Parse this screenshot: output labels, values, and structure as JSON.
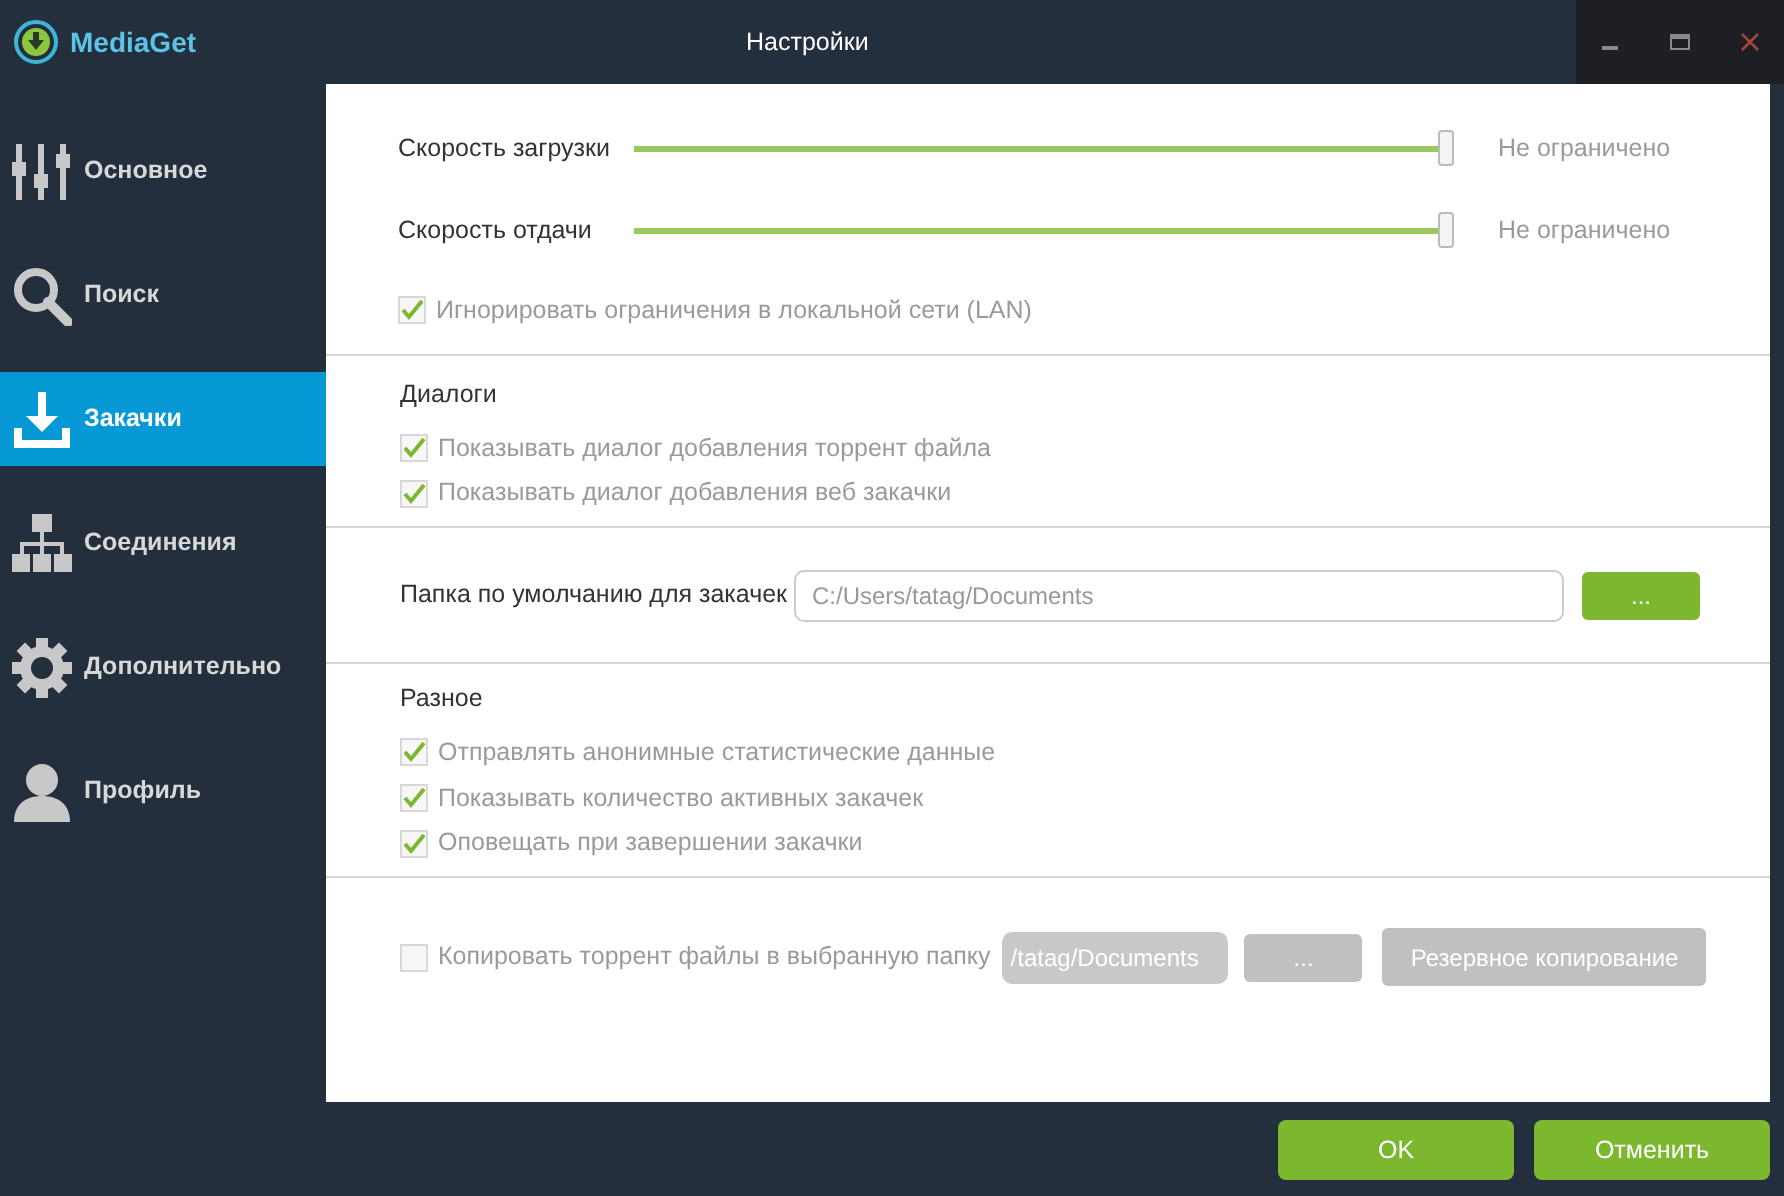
{
  "app": {
    "name": "MediaGet"
  },
  "window": {
    "title": "Настройки"
  },
  "sidebar": {
    "items": [
      {
        "label": "Основное",
        "selected": false
      },
      {
        "label": "Поиск",
        "selected": false
      },
      {
        "label": "Закачки",
        "selected": true
      },
      {
        "label": "Соединения",
        "selected": false
      },
      {
        "label": "Дополнительно",
        "selected": false
      },
      {
        "label": "Профиль",
        "selected": false
      }
    ]
  },
  "speed": {
    "sliders": [
      {
        "label": "Скорость загрузки",
        "level": 1,
        "reading": "Не ограничено"
      },
      {
        "label": "Скорость отдачи",
        "level": 1,
        "reading": "Не ограничено"
      }
    ],
    "options": [
      {
        "label": "Игнорировать ограничения в локальной сети (LAN)",
        "checked": true
      }
    ]
  },
  "dialogs": {
    "title": "Диалоги",
    "options": [
      {
        "label": "Показывать диалог добавления торрент файла",
        "checked": true
      },
      {
        "label": "Показывать диалог добавления веб закачки",
        "checked": true
      }
    ]
  },
  "folder": {
    "label": "Папка по умолчанию для закачек",
    "value": "C:/Users/tatag/Documents",
    "browse": "..."
  },
  "misc": {
    "title": "Разное",
    "options": [
      {
        "label": "Отправлять анонимные статистические данные",
        "checked": true
      },
      {
        "label": "Показывать количество активных закачек",
        "checked": true
      },
      {
        "label": "Оповещать при завершении закачки",
        "checked": true
      }
    ]
  },
  "copy": {
    "label": "Копировать торрент файлы в выбранную папку",
    "checked": false,
    "value": "/tatag/Documents",
    "browse": "...",
    "backup": "Резервное копирование",
    "disabled": true
  },
  "buttons": [
    {
      "label": "OK"
    },
    {
      "label": "Отменить"
    }
  ]
}
